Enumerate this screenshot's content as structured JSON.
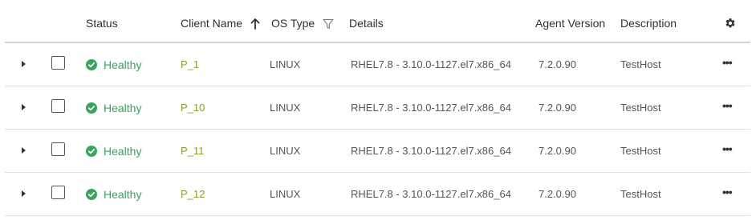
{
  "columns": {
    "status": "Status",
    "client_name": "Client Name",
    "os_type": "OS Type",
    "details": "Details",
    "agent_version": "Agent Version",
    "description": "Description"
  },
  "rows": [
    {
      "status": "Healthy",
      "client": "P_1",
      "os": "LINUX",
      "details": "RHEL7.8 - 3.10.0-1127.el7.x86_64",
      "version": "7.2.0.90",
      "description": "TestHost"
    },
    {
      "status": "Healthy",
      "client": "P_10",
      "os": "LINUX",
      "details": "RHEL7.8 - 3.10.0-1127.el7.x86_64",
      "version": "7.2.0.90",
      "description": "TestHost"
    },
    {
      "status": "Healthy",
      "client": "P_11",
      "os": "LINUX",
      "details": "RHEL7.8 - 3.10.0-1127.el7.x86_64",
      "version": "7.2.0.90",
      "description": "TestHost"
    },
    {
      "status": "Healthy",
      "client": "P_12",
      "os": "LINUX",
      "details": "RHEL7.8 - 3.10.0-1127.el7.x86_64",
      "version": "7.2.0.90",
      "description": "TestHost"
    }
  ],
  "icons": {
    "status_ok": "check-circle-icon",
    "sort": "arrow-up-icon",
    "filter": "funnel-icon",
    "settings": "gear-icon",
    "row_menu": "more-horizontal-icon",
    "expand": "caret-right-icon"
  },
  "colors": {
    "healthy": "#3aa35c",
    "client_link": "#8c9c2a"
  }
}
